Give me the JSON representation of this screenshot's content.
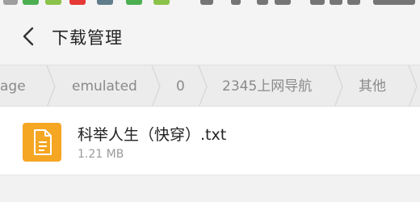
{
  "header": {
    "title": "下载管理",
    "back_icon": "back-arrow-icon"
  },
  "breadcrumb": {
    "items": [
      "age",
      "emulated",
      "0",
      "2345上网导航",
      "其他"
    ]
  },
  "files": [
    {
      "name": "科举人生（快穿）.txt",
      "size": "1.21 MB",
      "icon": "text-file-icon",
      "icon_color": "#f5a623"
    }
  ],
  "colors": {
    "accent_file": "#f5a623",
    "breadcrumb_text": "#8a8a8a",
    "background": "#f2f2f2"
  }
}
